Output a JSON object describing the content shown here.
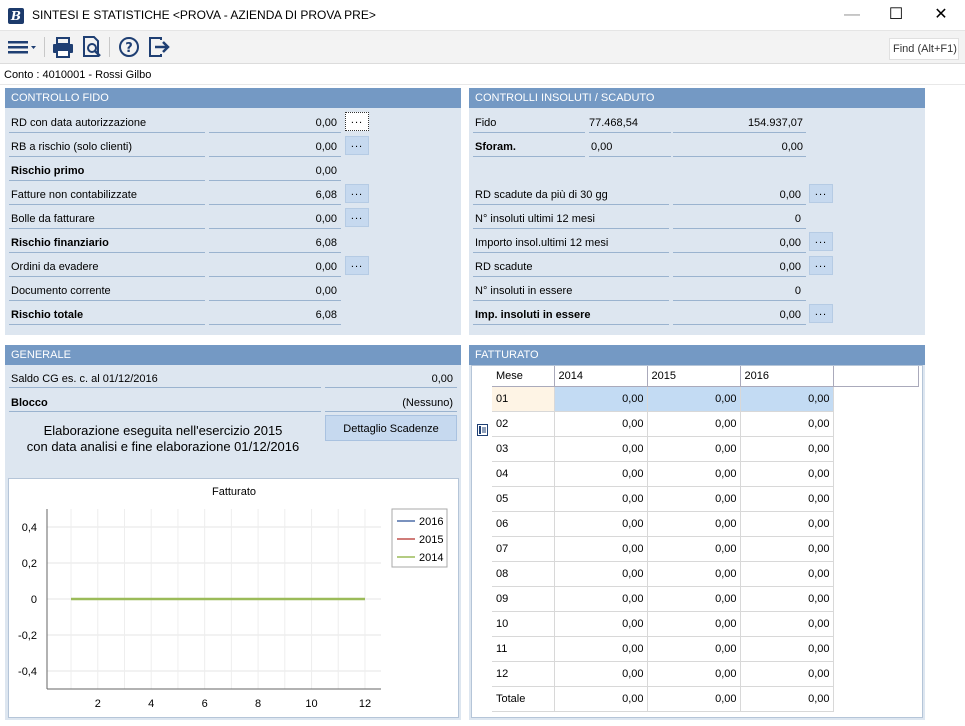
{
  "window": {
    "title": "SINTESI E STATISTICHE <PROVA - AZIENDA DI PROVA PRE>",
    "controls": {
      "minimize": "—",
      "maximize": "☐",
      "close": "✕"
    }
  },
  "toolbar": {
    "icons": [
      "menu-icon",
      "print-icon",
      "print-preview-icon",
      "help-icon",
      "exit-icon"
    ],
    "find_label": "Find (Alt+F1)"
  },
  "conto": "Conto : 4010001 - Rossi Gilbo",
  "controllo_fido": {
    "title": "CONTROLLO FIDO",
    "rows": [
      {
        "label": "RD con data autorizzazione",
        "value": "0,00",
        "bold": false,
        "has_button": true
      },
      {
        "label": "RB a rischio (solo clienti)",
        "value": "0,00",
        "bold": false,
        "has_button": true
      },
      {
        "label": "Rischio primo",
        "value": "0,00",
        "bold": true,
        "has_button": false
      },
      {
        "label": "Fatture non contabilizzate",
        "value": "6,08",
        "bold": false,
        "has_button": true
      },
      {
        "label": "Bolle da fatturare",
        "value": "0,00",
        "bold": false,
        "has_button": true
      },
      {
        "label": "Rischio finanziario",
        "value": "6,08",
        "bold": true,
        "has_button": false
      },
      {
        "label": "Ordini da evadere",
        "value": "0,00",
        "bold": false,
        "has_button": true
      },
      {
        "label": "Documento corrente",
        "value": "0,00",
        "bold": false,
        "has_button": false
      },
      {
        "label": "Rischio totale",
        "value": "6,08",
        "bold": true,
        "has_button": false
      }
    ],
    "button_label": "..."
  },
  "controlli_insoluti": {
    "title": "CONTROLLI INSOLUTI / SCADUTO",
    "fido": {
      "label": "Fido",
      "value1": "77.468,54",
      "value2": "154.937,07"
    },
    "sforam": {
      "label": "Sforam.",
      "value1": "0,00",
      "value2": "0,00"
    },
    "rows": [
      {
        "label": "RD scadute da più di 30 gg",
        "value": "0,00",
        "bold": false,
        "has_button": true
      },
      {
        "label": "N° insoluti ultimi 12 mesi",
        "value": "0",
        "bold": false,
        "has_button": false
      },
      {
        "label": "Importo insol.ultimi 12 mesi",
        "value": "0,00",
        "bold": false,
        "has_button": true
      },
      {
        "label": "RD scadute",
        "value": "0,00",
        "bold": false,
        "has_button": true
      },
      {
        "label": "N° insoluti in essere",
        "value": "0",
        "bold": false,
        "has_button": false
      },
      {
        "label": "Imp. insoluti in essere",
        "value": "0,00",
        "bold": true,
        "has_button": true
      }
    ]
  },
  "generale": {
    "title": "GENERALE",
    "saldo": {
      "label": "Saldo CG es. c. al 01/12/2016",
      "value": "0,00"
    },
    "blocco": {
      "label": "Blocco",
      "value": "(Nessuno)"
    },
    "note_line1": "Elaborazione eseguita nell'esercizio 2015",
    "note_line2": "con data analisi e fine elaborazione 01/12/2016",
    "dettaglio_button": "Dettaglio Scadenze"
  },
  "chart_data": {
    "type": "line",
    "title": "Fatturato",
    "xlabel": "",
    "ylabel": "",
    "x": [
      1,
      2,
      3,
      4,
      5,
      6,
      7,
      8,
      9,
      10,
      11,
      12
    ],
    "xticks": [
      2,
      4,
      6,
      8,
      10,
      12
    ],
    "xlim": [
      0.1,
      12.6
    ],
    "yticks": [
      -0.4,
      -0.2,
      0,
      0.2,
      0.4
    ],
    "ytick_labels": [
      "-0,4",
      "-0,2",
      "0",
      "0,2",
      "0,4"
    ],
    "ylim": [
      -0.5,
      0.5
    ],
    "grid": true,
    "legend_position": "top-right",
    "series": [
      {
        "name": "2016",
        "color": "#4f6fa8",
        "values": [
          0,
          0,
          0,
          0,
          0,
          0,
          0,
          0,
          0,
          0,
          0,
          0
        ]
      },
      {
        "name": "2015",
        "color": "#c0504d",
        "values": [
          0,
          0,
          0,
          0,
          0,
          0,
          0,
          0,
          0,
          0,
          0,
          0
        ]
      },
      {
        "name": "2014",
        "color": "#9bbb59",
        "values": [
          0,
          0,
          0,
          0,
          0,
          0,
          0,
          0,
          0,
          0,
          0,
          0
        ]
      }
    ]
  },
  "fatturato": {
    "title": "FATTURATO",
    "columns": [
      "Mese",
      "2014",
      "2015",
      "2016"
    ],
    "rows": [
      {
        "mese": "01",
        "v2014": "0,00",
        "v2015": "0,00",
        "v2016": "0,00"
      },
      {
        "mese": "02",
        "v2014": "0,00",
        "v2015": "0,00",
        "v2016": "0,00"
      },
      {
        "mese": "03",
        "v2014": "0,00",
        "v2015": "0,00",
        "v2016": "0,00"
      },
      {
        "mese": "04",
        "v2014": "0,00",
        "v2015": "0,00",
        "v2016": "0,00"
      },
      {
        "mese": "05",
        "v2014": "0,00",
        "v2015": "0,00",
        "v2016": "0,00"
      },
      {
        "mese": "06",
        "v2014": "0,00",
        "v2015": "0,00",
        "v2016": "0,00"
      },
      {
        "mese": "07",
        "v2014": "0,00",
        "v2015": "0,00",
        "v2016": "0,00"
      },
      {
        "mese": "08",
        "v2014": "0,00",
        "v2015": "0,00",
        "v2016": "0,00"
      },
      {
        "mese": "09",
        "v2014": "0,00",
        "v2015": "0,00",
        "v2016": "0,00"
      },
      {
        "mese": "10",
        "v2014": "0,00",
        "v2015": "0,00",
        "v2016": "0,00"
      },
      {
        "mese": "11",
        "v2014": "0,00",
        "v2015": "0,00",
        "v2016": "0,00"
      },
      {
        "mese": "12",
        "v2014": "0,00",
        "v2015": "0,00",
        "v2016": "0,00"
      },
      {
        "mese": "Totale",
        "v2014": "0,00",
        "v2015": "0,00",
        "v2016": "0,00"
      }
    ]
  }
}
